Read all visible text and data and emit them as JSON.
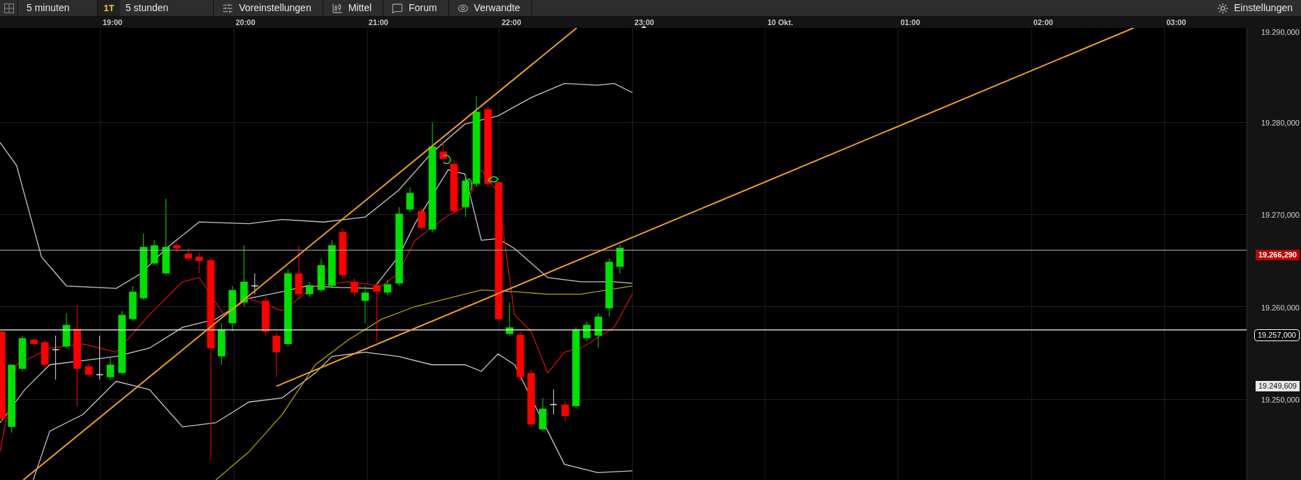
{
  "toolbar": {
    "items": [
      {
        "kind": "interval",
        "label": "5 minuten"
      },
      {
        "kind": "range",
        "badge": "1T",
        "label": "5 stunden"
      },
      {
        "kind": "presets",
        "label": "Voreinstellungen"
      },
      {
        "kind": "indicators",
        "label": "Mittel"
      },
      {
        "kind": "forum",
        "label": "Forum"
      },
      {
        "kind": "related",
        "label": "Verwandte"
      }
    ],
    "settings": {
      "label": "Einstellungen"
    }
  },
  "time_axis": {
    "labels": [
      "19:00",
      "20:00",
      "21:00",
      "22:00",
      "23:00",
      "10 Okt.",
      "01:00",
      "02:00",
      "03:00"
    ]
  },
  "price_axis": {
    "ticks": [
      "19.290,000",
      "19.280,000",
      "19.270,000",
      "19.260,000",
      "19.250,000"
    ],
    "markers": [
      {
        "kind": "last",
        "label": "19.266,290"
      },
      {
        "kind": "level",
        "label": "19.257,000"
      },
      {
        "kind": "cursor",
        "label": "19.249,609"
      }
    ]
  }
}
